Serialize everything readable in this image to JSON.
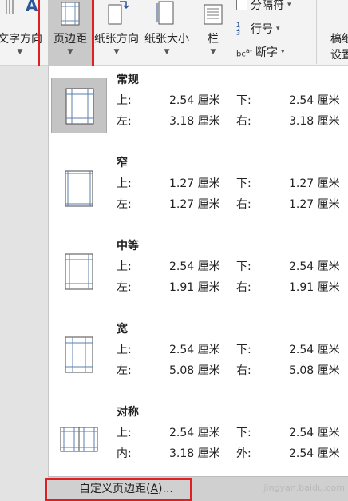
{
  "ribbon": {
    "text_direction_label": "文字方向",
    "margins_label": "页边距",
    "orientation_label": "纸张方向",
    "size_label": "纸张大小",
    "columns_label": "栏",
    "breaks_label": "分隔符",
    "line_numbers_label": "行号",
    "hyphenation_label": "断字",
    "draft_label": "稿纸",
    "settings_label": "设置"
  },
  "highlight_color": "#e02020",
  "presets": [
    {
      "name": "常规",
      "top_label": "上:",
      "top": "2.54 厘米",
      "bottom_label": "下:",
      "bottom": "2.54 厘米",
      "left_label": "左:",
      "left": "3.18 厘米",
      "right_label": "右:",
      "right": "3.18 厘米"
    },
    {
      "name": "窄",
      "top_label": "上:",
      "top": "1.27 厘米",
      "bottom_label": "下:",
      "bottom": "1.27 厘米",
      "left_label": "左:",
      "left": "1.27 厘米",
      "right_label": "右:",
      "right": "1.27 厘米"
    },
    {
      "name": "中等",
      "top_label": "上:",
      "top": "2.54 厘米",
      "bottom_label": "下:",
      "bottom": "2.54 厘米",
      "left_label": "左:",
      "left": "1.91 厘米",
      "right_label": "右:",
      "right": "1.91 厘米"
    },
    {
      "name": "宽",
      "top_label": "上:",
      "top": "2.54 厘米",
      "bottom_label": "下:",
      "bottom": "2.54 厘米",
      "left_label": "左:",
      "left": "5.08 厘米",
      "right_label": "右:",
      "right": "5.08 厘米"
    },
    {
      "name": "对称",
      "top_label": "上:",
      "top": "2.54 厘米",
      "bottom_label": "下:",
      "bottom": "2.54 厘米",
      "left_label": "内:",
      "left": "3.18 厘米",
      "right_label": "外:",
      "right": "2.54 厘米"
    }
  ],
  "footer": {
    "custom_prefix": "自定义页边距(",
    "custom_key": "A",
    "custom_suffix": ")..."
  },
  "watermark": "jingyan.baidu.com"
}
